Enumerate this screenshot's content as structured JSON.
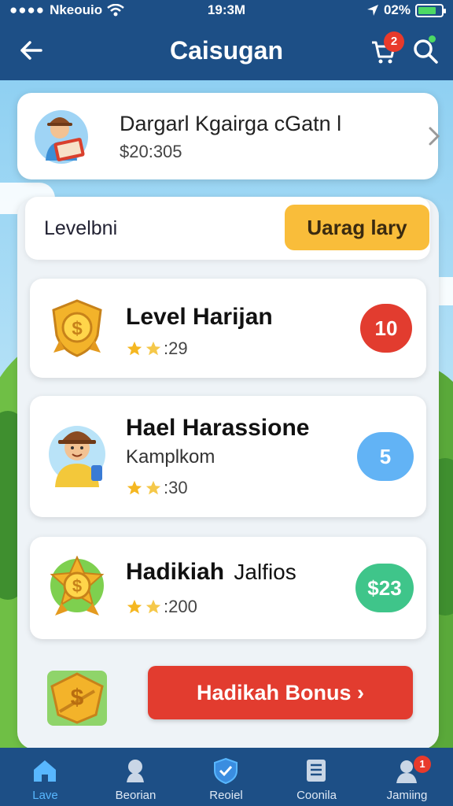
{
  "status_bar": {
    "carrier": "Nkeouio",
    "time": "19:3M",
    "battery_text": "02%",
    "battery_level": 0.8
  },
  "header": {
    "title": "Caisugan",
    "cart_badge": "2"
  },
  "profile": {
    "name": "Dargarl Kgairga cGatn l",
    "balance": "$20:305"
  },
  "level_bar": {
    "label": "Levelbni",
    "upgrade_button": "Uarag lary"
  },
  "items": [
    {
      "title": "Level Harijan",
      "rating": ":29",
      "badge": "10",
      "badge_color": "#e23c2f",
      "icon": "shield-coin-icon"
    },
    {
      "title": "Hael Harassione",
      "subtitle": "Kamplkom",
      "rating": ":30",
      "badge": "5",
      "badge_color": "#62b3f5",
      "icon": "explorer-avatar-icon"
    },
    {
      "title": "Hadikiah",
      "title_suffix": "Jalfios",
      "rating": ":200",
      "badge": "$23",
      "badge_color": "#3fc58a",
      "icon": "star-coin-icon"
    }
  ],
  "bonus": {
    "button": "Hadikah Bonus",
    "arrow": "›"
  },
  "tabs": [
    {
      "label": "Lave",
      "icon": "home-icon",
      "active": true
    },
    {
      "label": "Beorian",
      "icon": "explore-icon",
      "active": false
    },
    {
      "label": "Reoiel",
      "icon": "shield-check-icon",
      "active": false
    },
    {
      "label": "Coonila",
      "icon": "list-icon",
      "active": false
    },
    {
      "label": "Jamiing",
      "icon": "profile-icon",
      "active": false,
      "badge": "1"
    }
  ],
  "colors": {
    "header_bg": "#1d4f86",
    "accent_yellow": "#f9bd3a",
    "accent_red": "#e23c2f"
  }
}
